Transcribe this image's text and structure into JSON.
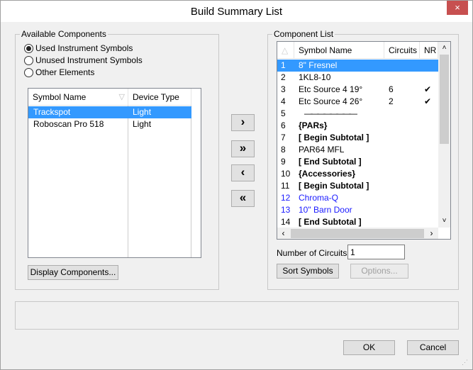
{
  "window": {
    "title": "Build Summary List",
    "close_icon": "×"
  },
  "available": {
    "label": "Available Components",
    "radios": [
      {
        "label": "Used Instrument Symbols",
        "checked": true
      },
      {
        "label": "Unused Instrument Symbols",
        "checked": false
      },
      {
        "label": "Other Elements",
        "checked": false
      }
    ],
    "columns": [
      "Symbol Name",
      "Device Type"
    ],
    "rows": [
      {
        "name": "Trackspot",
        "type": "Light",
        "selected": true
      },
      {
        "name": "Roboscan Pro 518",
        "type": "Light",
        "selected": false
      }
    ],
    "display_button": "Display Components..."
  },
  "transfer": {
    "add": "›",
    "add_all": "»",
    "remove": "‹",
    "remove_all": "«"
  },
  "component_list": {
    "label": "Component List",
    "columns": [
      "Symbol Name",
      "Circuits",
      "NR"
    ],
    "rows": [
      {
        "n": "1",
        "name": "8\" Fresnel",
        "circuits": "",
        "nr": "",
        "style": "sel"
      },
      {
        "n": "2",
        "name": "1KL8-10",
        "circuits": "",
        "nr": "",
        "style": ""
      },
      {
        "n": "3",
        "name": "Etc Source 4 19°",
        "circuits": "6",
        "nr": "✔",
        "style": ""
      },
      {
        "n": "4",
        "name": "Etc Source 4 26°",
        "circuits": "2",
        "nr": "✔",
        "style": ""
      },
      {
        "n": "5",
        "name": "————————",
        "circuits": "",
        "nr": "",
        "style": "sep"
      },
      {
        "n": "6",
        "name": "{PARs}",
        "circuits": "",
        "nr": "",
        "style": "bold"
      },
      {
        "n": "7",
        "name": "[ Begin Subtotal ]",
        "circuits": "",
        "nr": "",
        "style": "bold"
      },
      {
        "n": "8",
        "name": "PAR64 MFL",
        "circuits": "",
        "nr": "",
        "style": ""
      },
      {
        "n": "9",
        "name": "[  End Subtotal  ]",
        "circuits": "",
        "nr": "",
        "style": "bold"
      },
      {
        "n": "10",
        "name": "{Accessories}",
        "circuits": "",
        "nr": "",
        "style": "bold"
      },
      {
        "n": "11",
        "name": "[ Begin Subtotal ]",
        "circuits": "",
        "nr": "",
        "style": "bold"
      },
      {
        "n": "12",
        "name": "Chroma-Q",
        "circuits": "",
        "nr": "",
        "style": "blue"
      },
      {
        "n": "13",
        "name": "10\" Barn Door",
        "circuits": "",
        "nr": "",
        "style": "blue"
      },
      {
        "n": "14",
        "name": "[  End Subtotal  ]",
        "circuits": "",
        "nr": "",
        "style": "bold"
      }
    ],
    "num_circuits_label": "Number of Circuits:",
    "num_circuits_value": "1",
    "sort_button": "Sort Symbols",
    "options_button": "Options..."
  },
  "status_text": "",
  "footer": {
    "ok": "OK",
    "cancel": "Cancel"
  }
}
